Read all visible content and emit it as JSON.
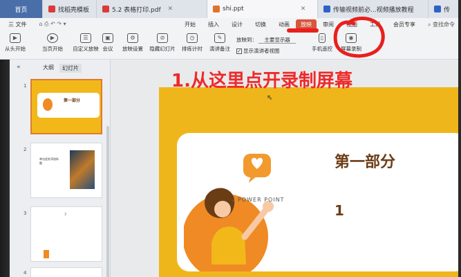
{
  "tabs": [
    {
      "label": "首页",
      "type": "home"
    },
    {
      "label": "找稻壳模板",
      "icon_color": "#d93b3b"
    },
    {
      "label": "5.2 表格打印.pdf",
      "icon_color": "#d93b3b"
    },
    {
      "label": "shi.ppt",
      "icon_color": "#e0732a",
      "active": true
    },
    {
      "label": "传输视频前必...视频播放教程",
      "icon_color": "#2f62c8"
    },
    {
      "label": "传",
      "icon_color": "#2f62c8"
    }
  ],
  "menu": {
    "file": "三 文件",
    "items": [
      "开始",
      "插入",
      "设计",
      "切换",
      "动画",
      "放映",
      "审阅",
      "视图",
      "工具",
      "会员专享"
    ],
    "selected": "放映",
    "search": "查找命令"
  },
  "ribbon": {
    "buttons": [
      "从头开始",
      "当页开始",
      "自定义放映",
      "会议",
      "放映设置",
      "隐藏幻灯片",
      "排练计时",
      "演讲备注"
    ],
    "play_to_label": "放映到：",
    "play_to_value": "主要显示器",
    "presenter_view": "显示演讲者视图",
    "phone_remote": "手机遥控",
    "screen_record": "屏幕录制"
  },
  "left_panel": {
    "tabs": [
      "大纲",
      "幻灯片"
    ],
    "active_tab": "幻灯片",
    "slides": [
      {
        "num": "1",
        "title": "第一部分"
      },
      {
        "num": "2",
        "title": "单击此处添加标题"
      },
      {
        "num": "3",
        "title": "3"
      },
      {
        "num": "4",
        "title": ""
      }
    ]
  },
  "slide": {
    "title": "第一部分",
    "subtitle": "POWER POINT",
    "number": "1"
  },
  "annotation": "1.从这里点开录制屏幕",
  "colors": {
    "accent": "#d7563d",
    "slide_bg": "#efb61c",
    "title": "#6b3d15",
    "annotation": "#ee2a2a"
  }
}
